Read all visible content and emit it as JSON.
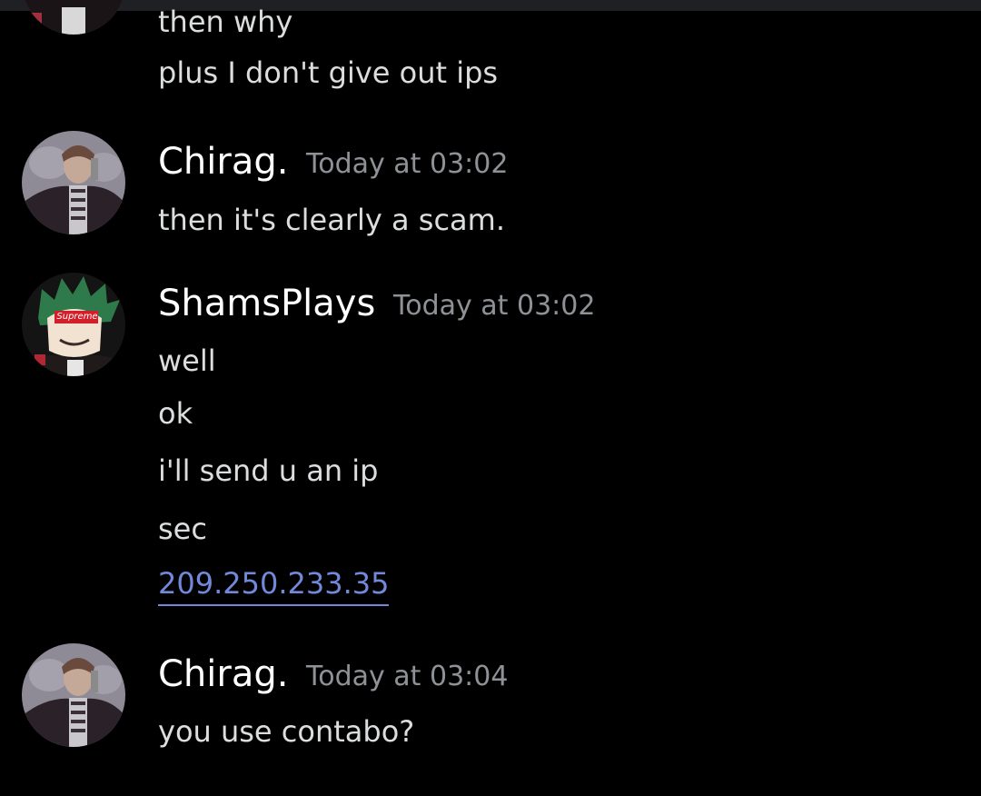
{
  "messages_before": [
    "then why",
    "plus I don't give out ips"
  ],
  "groups": [
    {
      "author": "Chirag.",
      "timestamp": "Today at 03:02",
      "messages": [
        "then it's clearly a scam."
      ]
    },
    {
      "author": "ShamsPlays",
      "timestamp": "Today at 03:02",
      "avatar_text": "Supreme",
      "messages": [
        "well",
        "ok",
        "i'll send u an ip",
        "sec"
      ],
      "link": "209.250.233.35"
    },
    {
      "author": "Chirag.",
      "timestamp": "Today at 03:04",
      "messages": [
        "you use contabo?"
      ]
    }
  ],
  "colors": {
    "background": "#000000",
    "username": "#ffffff",
    "timestamp": "#8e9297",
    "message": "#dcddde",
    "link": "#7289da"
  }
}
